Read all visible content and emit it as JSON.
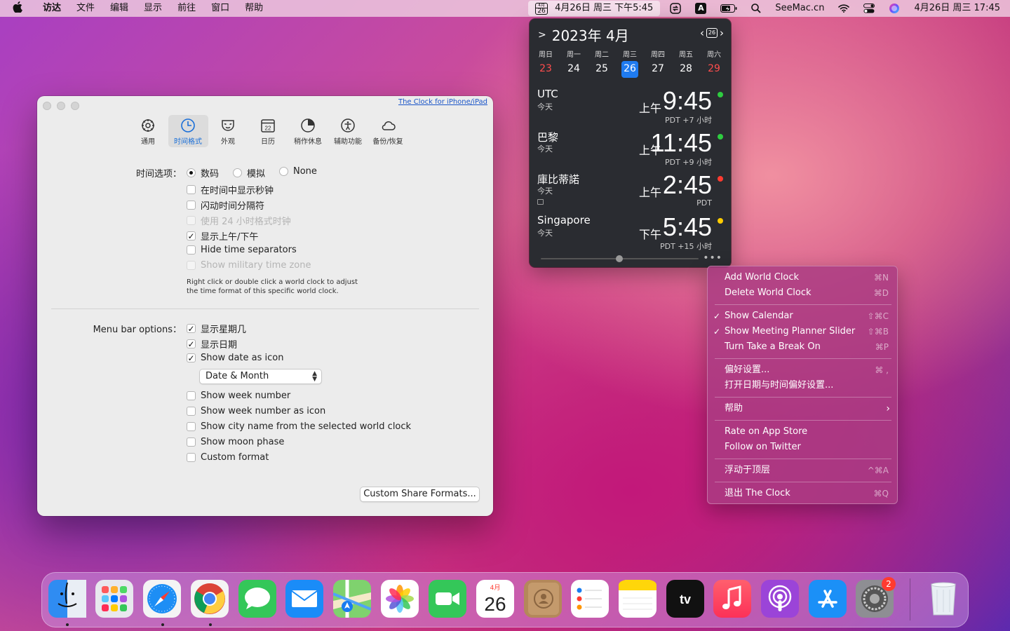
{
  "menubar": {
    "apple": "",
    "items": [
      "访达",
      "文件",
      "编辑",
      "显示",
      "前往",
      "窗口",
      "帮助"
    ],
    "clock_icon_month": "4月",
    "clock_icon_day": "26",
    "clock_app_text": "4月26日 周三  下午5:45",
    "text_icon": "A",
    "site": "SeeMac.cn",
    "datetime": "4月26日 周三  17:45"
  },
  "prefs": {
    "link": "The Clock for iPhone/iPad",
    "toolbar": [
      {
        "label": "通用",
        "icon": "gear-icon"
      },
      {
        "label": "时间格式",
        "icon": "clock-icon",
        "active": true
      },
      {
        "label": "外观",
        "icon": "mask-icon"
      },
      {
        "label": "日历",
        "icon": "calendar-icon",
        "day": "22"
      },
      {
        "label": "稍作休息",
        "icon": "pie-icon"
      },
      {
        "label": "辅助功能",
        "icon": "accessibility-icon"
      },
      {
        "label": "备份/恢复",
        "icon": "cloud-icon"
      }
    ],
    "time_options_label": "时间选项：",
    "radios": [
      {
        "label": "数码",
        "checked": true
      },
      {
        "label": "模拟",
        "checked": false
      },
      {
        "label": "None",
        "checked": false
      }
    ],
    "time_checks": [
      {
        "label": "在时间中显示秒钟",
        "checked": false,
        "disabled": false
      },
      {
        "label": "闪动时间分隔符",
        "checked": false,
        "disabled": false
      },
      {
        "label": "使用 24 小时格式时钟",
        "checked": false,
        "disabled": true
      },
      {
        "label": "显示上午/下午",
        "checked": true,
        "disabled": false
      },
      {
        "label": "Hide time separators",
        "checked": false,
        "disabled": false
      },
      {
        "label": "Show military time zone",
        "checked": false,
        "disabled": true
      }
    ],
    "note_line1": "Right click or double click a world clock to adjust",
    "note_line2": "the time format of this specific world clock.",
    "menubar_options_label": "Menu bar options：",
    "menubar_checks": [
      {
        "label": "显示星期几",
        "checked": true
      },
      {
        "label": "显示日期",
        "checked": true
      },
      {
        "label": "Show date as icon",
        "checked": true
      }
    ],
    "popup_value": "Date & Month",
    "more_checks": [
      {
        "label": "Show week number",
        "checked": false
      },
      {
        "label": "Show week number as icon",
        "checked": false
      },
      {
        "label": "Show city name from the selected world clock",
        "checked": false
      },
      {
        "label": "Show moon phase",
        "checked": false
      },
      {
        "label": "Custom format",
        "checked": false
      }
    ],
    "share_button": "Custom Share Formats..."
  },
  "panel": {
    "month": "2023年 4月",
    "cal_day": "26",
    "weekdays": [
      "周日",
      "周一",
      "周二",
      "周三",
      "周四",
      "周五",
      "周六"
    ],
    "dates": [
      "23",
      "24",
      "25",
      "26",
      "27",
      "28",
      "29"
    ],
    "today_index": 3,
    "zones": [
      {
        "city": "UTC",
        "day": "今天",
        "ampm": "上午",
        "time": "9:45",
        "offset": "PDT +7 小时",
        "dot": "#2ecc40"
      },
      {
        "city": "巴黎",
        "day": "今天",
        "ampm": "上午",
        "time": "11:45",
        "offset": "PDT +9 小时",
        "dot": "#2ecc40"
      },
      {
        "city": "庫比蒂諾",
        "day": "今天",
        "ampm": "上午",
        "time": "2:45",
        "offset": "PDT",
        "dot": "#ff3b30"
      },
      {
        "city": "Singapore",
        "day": "今天",
        "ampm": "下午",
        "time": "5:45",
        "offset": "PDT +15 小时",
        "dot": "#ffcc00"
      }
    ],
    "more": "•••"
  },
  "context_menu": [
    {
      "label": "Add World Clock",
      "shortcut": "⌘N",
      "checked": false
    },
    {
      "label": "Delete World Clock",
      "shortcut": "⌘D",
      "checked": false
    },
    {
      "label": "Show Calendar",
      "shortcut": "⇧⌘C",
      "checked": true
    },
    {
      "label": "Show Meeting Planner Slider",
      "shortcut": "⇧⌘B",
      "checked": true
    },
    {
      "label": "Turn Take a Break On",
      "shortcut": "⌘P",
      "checked": false
    },
    {
      "label": "偏好设置...",
      "shortcut": "⌘ ,",
      "checked": false
    },
    {
      "label": "打开日期与时间偏好设置...",
      "shortcut": "",
      "checked": false
    },
    {
      "label": "帮助",
      "shortcut": "",
      "submenu": true
    },
    {
      "label": "Rate on App Store",
      "shortcut": ""
    },
    {
      "label": "Follow on Twitter",
      "shortcut": ""
    },
    {
      "label": "浮动于顶层",
      "shortcut": "^⌘A"
    },
    {
      "label": "退出 The Clock",
      "shortcut": "⌘Q"
    }
  ],
  "dock": {
    "apps": [
      "finder",
      "launchpad",
      "safari",
      "chrome",
      "messages",
      "mail",
      "maps",
      "photos",
      "facetime",
      "calendar",
      "contacts",
      "reminders",
      "notes",
      "tv",
      "music",
      "podcasts",
      "app-store",
      "system-preferences",
      "trash"
    ],
    "calendar_month": "4月",
    "calendar_day": "26",
    "settings_badge": "2",
    "colors": {
      "accent": "#1f7bf0"
    }
  }
}
